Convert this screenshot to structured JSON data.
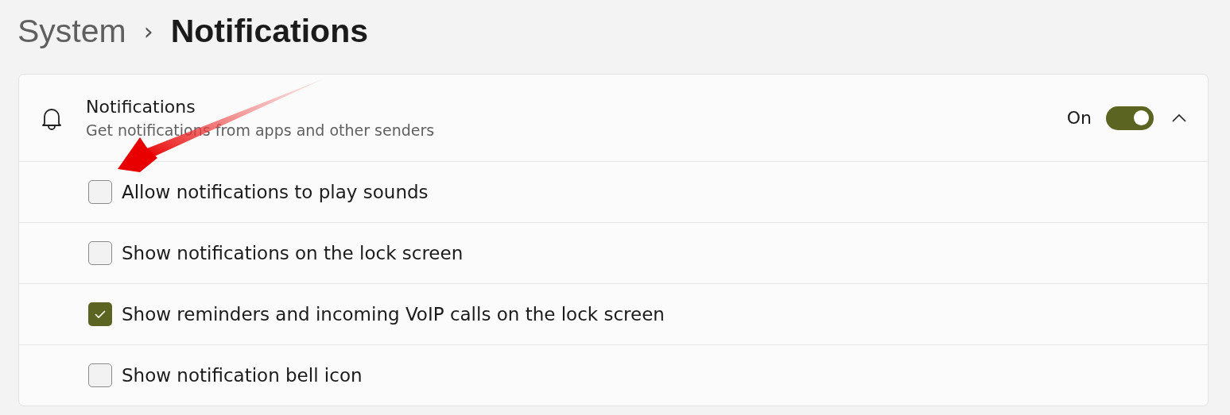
{
  "breadcrumb": {
    "parent": "System",
    "separator": "›",
    "current": "Notifications"
  },
  "notifications": {
    "title": "Notifications",
    "subtitle": "Get notifications from apps and other senders",
    "state_label": "On",
    "on": true,
    "expanded": true
  },
  "options": [
    {
      "label": "Allow notifications to play sounds",
      "checked": false
    },
    {
      "label": "Show notifications on the lock screen",
      "checked": false
    },
    {
      "label": "Show reminders and incoming VoIP calls on the lock screen",
      "checked": true
    },
    {
      "label": "Show notification bell icon",
      "checked": false
    }
  ]
}
